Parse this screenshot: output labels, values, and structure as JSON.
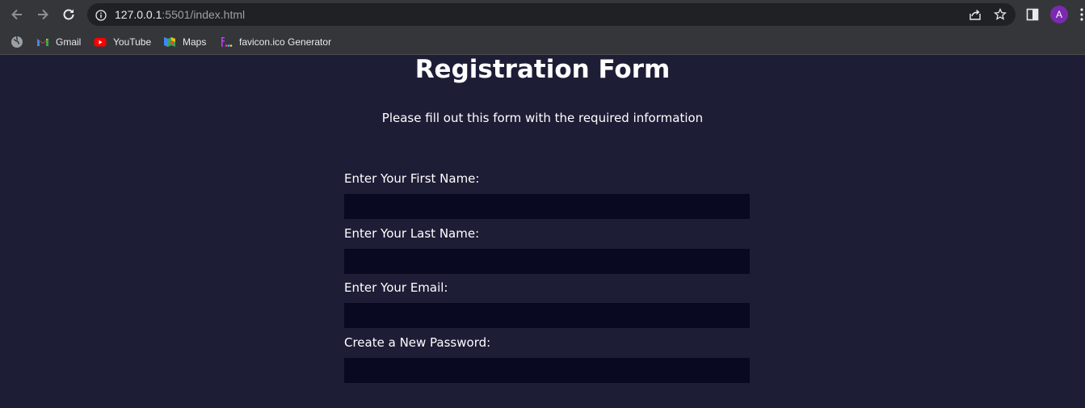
{
  "browser": {
    "url_host": "127.0.0.1",
    "url_rest": ":5501/index.html",
    "profile_initial": "A",
    "accent_color": "#7b2ab0",
    "bookmarks": [
      {
        "label": "Gmail",
        "icon": "gmail-icon"
      },
      {
        "label": "YouTube",
        "icon": "youtube-icon"
      },
      {
        "label": "Maps",
        "icon": "maps-icon"
      },
      {
        "label": "favicon.ico Generator",
        "icon": "favicon-generator-icon"
      }
    ]
  },
  "page": {
    "background": "#1e1d36",
    "input_background": "#090a22",
    "title": "Registration Form",
    "subtitle": "Please fill out this form with the required information",
    "fields": [
      {
        "label": "Enter Your First Name:",
        "value": ""
      },
      {
        "label": "Enter Your Last Name:",
        "value": ""
      },
      {
        "label": "Enter Your Email:",
        "value": ""
      },
      {
        "label": "Create a New Password:",
        "value": ""
      }
    ]
  }
}
